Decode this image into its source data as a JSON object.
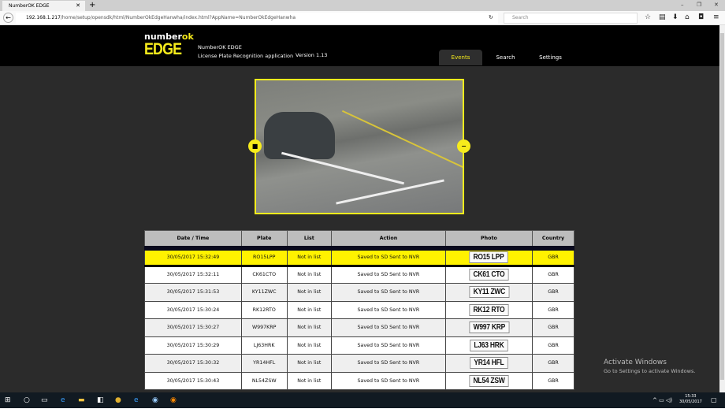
{
  "browser": {
    "tab_title": "NumberOK EDGE",
    "url_host": "192.168.1.217",
    "url_path": "/home/setup/opensdk/html/NumberOkEdgeHanwha/index.html?AppName=NumberOkEdgeHanwha",
    "search_placeholder": "Search"
  },
  "header": {
    "logo_top": "number",
    "logo_top_accent": "ok",
    "logo_main": "EDGE",
    "app_name": "NumberOK EDGE",
    "app_desc": "License Plate Recognition application",
    "version": "Version 1.13"
  },
  "nav": [
    {
      "label": "Events",
      "active": true
    },
    {
      "label": "Search"
    },
    {
      "label": "Settings"
    }
  ],
  "colors": {
    "accent": "#f7ec1c",
    "background": "#2b2b2b",
    "header": "#000000"
  },
  "table": {
    "columns": [
      "Date / Time",
      "Plate",
      "List",
      "Action",
      "Photo",
      "Country"
    ],
    "rows": [
      {
        "datetime": "30/05/2017 15:32:49",
        "plate": "RO15LPP",
        "list": "Not in list",
        "action": "Saved to SD Sent to NVR",
        "photo": "RO15 LPP",
        "country": "GBR",
        "selected": true
      },
      {
        "datetime": "30/05/2017 15:32:11",
        "plate": "CK61CTO",
        "list": "Not in list",
        "action": "Saved to SD Sent to NVR",
        "photo": "CK61 CTO",
        "country": "GBR"
      },
      {
        "datetime": "30/05/2017 15:31:53",
        "plate": "KY11ZWC",
        "list": "Not in list",
        "action": "Saved to SD Sent to NVR",
        "photo": "KY11 ZWC",
        "country": "GBR"
      },
      {
        "datetime": "30/05/2017 15:30:24",
        "plate": "RK12RTO",
        "list": "Not in list",
        "action": "Saved to SD Sent to NVR",
        "photo": "RK12 RTO",
        "country": "GBR"
      },
      {
        "datetime": "30/05/2017 15:30:27",
        "plate": "W997KRP",
        "list": "Not in list",
        "action": "Saved to SD Sent to NVR",
        "photo": "W997 KRP",
        "country": "GBR"
      },
      {
        "datetime": "30/05/2017 15:30:29",
        "plate": "LJ63HRK",
        "list": "Not in list",
        "action": "Saved to SD Sent to NVR",
        "photo": "LJ63 HRK",
        "country": "GBR"
      },
      {
        "datetime": "30/05/2017 15:30:32",
        "plate": "YR14HFL",
        "list": "Not in list",
        "action": "Saved to SD Sent to NVR",
        "photo": "YR14 HFL",
        "country": "GBR"
      },
      {
        "datetime": "30/05/2017 15:30:43",
        "plate": "NL54ZSW",
        "list": "Not in list",
        "action": "Saved to SD Sent to NVR",
        "photo": "NL54 ZSW",
        "country": "GBR"
      }
    ]
  },
  "watermark": {
    "title": "Activate Windows",
    "subtitle": "Go to Settings to activate Windows."
  },
  "clock": {
    "time": "15:33",
    "date": "30/05/2017"
  }
}
